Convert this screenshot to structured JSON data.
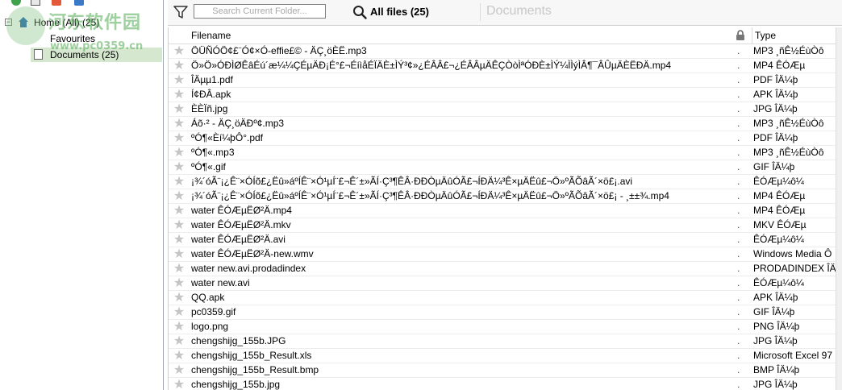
{
  "sidebar": {
    "toolbar": [
      "add-icon",
      "list-icon",
      "remove-icon",
      "user-icon"
    ],
    "tree": {
      "home_label": "Home (All) (25)",
      "expander": "−",
      "favourites_label": "Favourites",
      "documents_label": "Documents (25)"
    },
    "watermark": {
      "title": "河东软件园",
      "url": "www.pc0359.cn"
    }
  },
  "topbar": {
    "search_placeholder": "Search Current Folder...",
    "file_count": "All files (25)",
    "tab_label": "Documents"
  },
  "list": {
    "headers": {
      "filename": "Filename",
      "type": "Type"
    },
    "rows": [
      {
        "name": "ÖÜÑÓÖ¢£¨Ó¢×Ó-effie£© - ÄÇ¸öÈË.mp3",
        "type": "MP3 ¸ñÊ½ÉùÒô"
      },
      {
        "name": "Ö»Ö»ÓÐÌØÊâÉú´æ¼¼ÇÉµÄÐ¡É°£¬ÉíìåÉÏÄÈ±ÌÝ³¢»¿ÉÂÂ£¬¿ÉÂÂµÄÊÇÒòÌªÓÐÈ±ÌÝ¼ÌÌýÌÂ¶¯ÂÛµÄÈËÐÄ.mp4",
        "type": "MP4 ÊÓÆµ"
      },
      {
        "name": "ÎÄµµ1.pdf",
        "type": "PDF ÎÄ¼þ"
      },
      {
        "name": "Í¢ÐÂ.apk",
        "type": "APK ÎÄ¼þ"
      },
      {
        "name": "ÈÈÏñ.jpg",
        "type": "JPG ÎÄ¼þ"
      },
      {
        "name": "Áõ·² - ÄÇ¸öÄÐº¢.mp3",
        "type": "MP3 ¸ñÊ½ÉùÒô"
      },
      {
        "name": "ºÓ¶«Èí¼þÔ°.pdf",
        "type": "PDF ÎÄ¼þ"
      },
      {
        "name": "ºÓ¶«.mp3",
        "type": "MP3 ¸ñÊ½ÉùÒô"
      },
      {
        "name": "ºÓ¶«.gif",
        "type": "GIF ÎÄ¼þ"
      },
      {
        "name": "¡¾´óÃ¨¡¿Ê¨×ÓÍõ£¿Ëû»áºÍÊ¨×Ó¹µÍ¨£¬Ê´±»ÃÍ·Ç³¶ÊÂ·ÐÐÒµÄûÓÃ£¬ÍÐÄ¼³Ê×µÄËû£¬Ö»ºÃÕâÃ´×ö£¡.avi",
        "type": "ÊÓÆµ¼ô¼­"
      },
      {
        "name": "¡¾´óÃ¨¡¿Ê¨×ÓÍõ£¿Ëû»áºÍÊ¨×Ó¹µÍ¨£¬Ê´±»ÃÍ·Ç³¶ÊÂ·ÐÐÒµÄûÓÃ£¬ÍÐÄ¼³Ê×µÄËû£¬Ö»ºÃÕâÃ´×ö£¡ - ¸±±¾.mp4",
        "type": "MP4 ÊÓÆµ"
      },
      {
        "name": "water ÊÓÆµËØ²Ä.mp4",
        "type": "MP4 ÊÓÆµ"
      },
      {
        "name": "water ÊÓÆµËØ²Ä.mkv",
        "type": "MKV ÊÓÆµ"
      },
      {
        "name": "water ÊÓÆµËØ²Ä.avi",
        "type": "ÊÓÆµ¼ô¼­"
      },
      {
        "name": "water ÊÓÆµËØ²Ä-new.wmv",
        "type": "Windows Media Ô"
      },
      {
        "name": "water  new.avi.prodadindex",
        "type": "PRODADINDEX ÎÄ"
      },
      {
        "name": "water  new.avi",
        "type": "ÊÓÆµ¼ô¼­"
      },
      {
        "name": "QQ.apk",
        "type": "APK ÎÄ¼þ"
      },
      {
        "name": "pc0359.gif",
        "type": "GIF ÎÄ¼þ"
      },
      {
        "name": "logo.png",
        "type": "PNG ÎÄ¼þ"
      },
      {
        "name": "chengshijg_155b.JPG",
        "type": "JPG ÎÄ¼þ"
      },
      {
        "name": "chengshijg_155b_Result.xls",
        "type": "Microsoft Excel 97"
      },
      {
        "name": "chengshijg_155b_Result.bmp",
        "type": "BMP ÎÄ¼þ"
      },
      {
        "name": "chengshijg_155b.jpg",
        "type": "JPG ÎÄ¼þ"
      }
    ],
    "row_marker": "."
  },
  "colors": {
    "selected_bg": "#d6e7d0",
    "star": "#c4c4c4",
    "watermark": "#50aa50"
  }
}
